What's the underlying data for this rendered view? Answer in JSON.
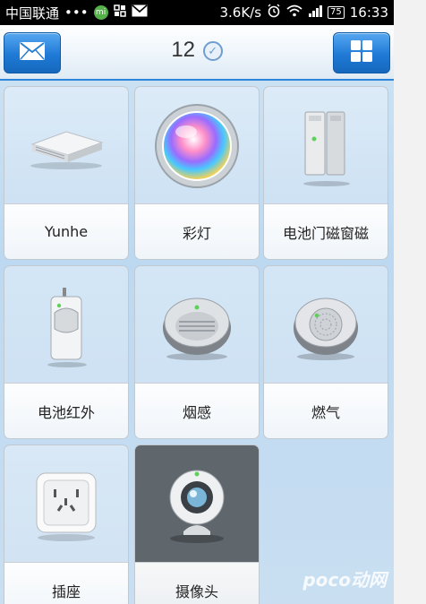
{
  "status_bar": {
    "carrier": "中国联通",
    "dots": "•••",
    "speed": "3.6K/s",
    "battery": "75",
    "time": "16:33",
    "icons": [
      "qq-icon",
      "grid-notification-icon",
      "mail-notification-icon",
      "alarm-icon",
      "wifi-icon",
      "signal-icon",
      "battery-icon"
    ]
  },
  "header": {
    "count": "12",
    "left_button_icon": "envelope-icon",
    "right_button_icon": "grid-icon",
    "count_badge_icon": "check-circle-icon"
  },
  "devices": [
    {
      "label": "Yunhe",
      "icon": "router-device-icon"
    },
    {
      "label": "彩灯",
      "icon": "color-light-icon"
    },
    {
      "label": "电池门磁窗磁",
      "icon": "door-sensor-icon"
    },
    {
      "label": "电池红外",
      "icon": "pir-sensor-icon"
    },
    {
      "label": "烟感",
      "icon": "smoke-detector-icon"
    },
    {
      "label": "燃气",
      "icon": "gas-detector-icon"
    },
    {
      "label": "插座",
      "icon": "socket-icon"
    },
    {
      "label": "摄像头",
      "icon": "camera-icon"
    }
  ],
  "watermark": "poco动网"
}
